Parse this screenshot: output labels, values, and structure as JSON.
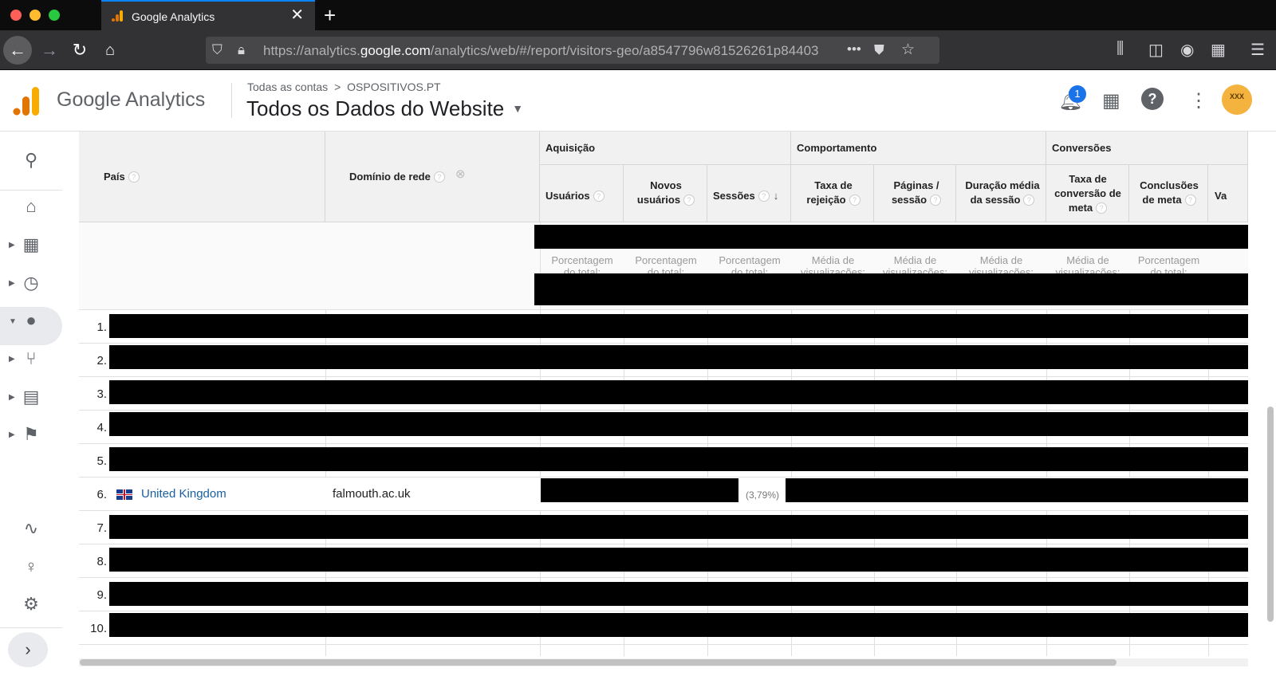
{
  "browser": {
    "tab_title": "Google Analytics",
    "url_prefix": "https://analytics.",
    "url_domain": "google.com",
    "url_suffix": "/analytics/web/#/report/visitors-geo/a8547796w81526261p84403",
    "url_more": "•••"
  },
  "ga_header": {
    "brand": "Google Analytics",
    "breadcrumb_root": "Todas as contas",
    "breadcrumb_sep": ">",
    "breadcrumb_account": "OSPOSITIVOS.PT",
    "view_title": "Todos os Dados do Website",
    "notification_count": "1",
    "avatar_text": "XXX"
  },
  "table": {
    "groups": {
      "acquisition": "Aquisição",
      "behavior": "Comportamento",
      "conversions": "Conversões"
    },
    "columns": {
      "country": "País",
      "domain": "Domínio de rede",
      "users": "Usuários",
      "new_users_1": "Novos",
      "new_users_2": "usuários",
      "sessions": "Sessões",
      "bounce_1": "Taxa de",
      "bounce_2": "rejeição",
      "pages_1": "Páginas /",
      "pages_2": "sessão",
      "duration_1": "Duração média",
      "duration_2": "da sessão",
      "conv_rate_1": "Taxa de",
      "conv_rate_2": "conversão de",
      "conv_rate_3": "meta",
      "goal_1": "Conclusões",
      "goal_2": "de meta",
      "value_cut": "Va"
    },
    "summary": {
      "pct_total_1": "Porcentagem",
      "pct_total_2": "do total:",
      "avg_view_1": "Média de",
      "avg_view_2": "visualizações:"
    },
    "rows": [
      {
        "num": "1."
      },
      {
        "num": "2."
      },
      {
        "num": "3."
      },
      {
        "num": "4."
      },
      {
        "num": "5."
      },
      {
        "num": "6.",
        "country": "United Kingdom",
        "domain": "falmouth.ac.uk",
        "sessions_pct": "(3,79%)"
      },
      {
        "num": "7."
      },
      {
        "num": "8."
      },
      {
        "num": "9."
      },
      {
        "num": "10."
      }
    ]
  },
  "icons": {
    "sidebar": [
      "search-icon",
      "home-icon",
      "customization-icon",
      "realtime-clock-icon",
      "audience-person-icon",
      "acquisition-icon",
      "behavior-icon",
      "conversions-flag-icon",
      "attribution-icon",
      "discover-bulb-icon",
      "admin-gear-icon",
      "expand-chevron-icon"
    ]
  },
  "colors": {
    "link": "#1a5fa0",
    "logo_orange": "#f9ab00",
    "logo_dark_orange": "#e37400",
    "firefox_accent": "#0a84ff"
  }
}
